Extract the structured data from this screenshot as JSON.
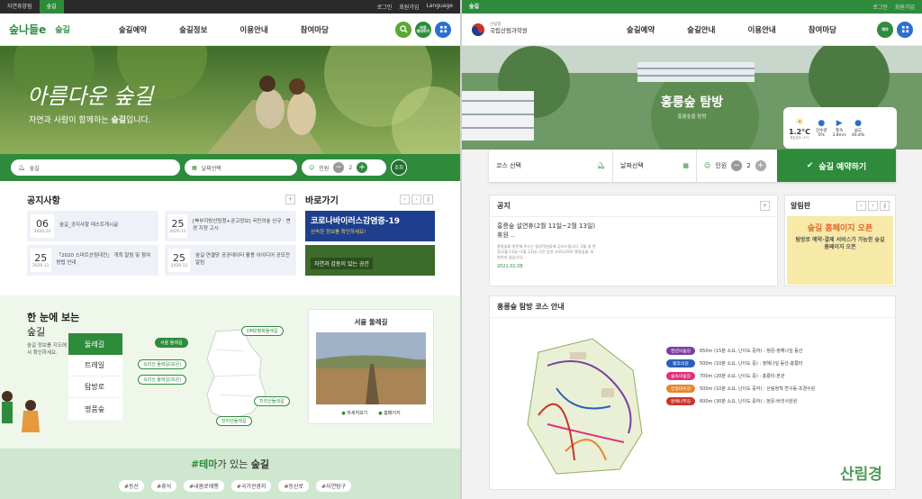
{
  "left": {
    "topbar": {
      "tabs": [
        "자연휴양림",
        "숲길"
      ],
      "util": [
        "로그인",
        "회원가입",
        "Language"
      ]
    },
    "logo": {
      "brand": "숲나들e",
      "section": "숲길"
    },
    "menu": [
      "숲길예약",
      "숲길정보",
      "이용안내",
      "참여마당"
    ],
    "nav_icons": {
      "search": "search-icon",
      "quick": "바로\n예약하기",
      "grid": "grid-icon"
    },
    "hero": {
      "title": "아름다운 숲길",
      "subtitle_pre": "자연과 사람이 함께하는 ",
      "subtitle_bold": "숲길",
      "subtitle_post": "입니다."
    },
    "search": {
      "forest": "숲길",
      "date": "날짜선택",
      "people_label": "인원",
      "people_count": "2",
      "submit": "조회"
    },
    "notice": {
      "title": "공지사항",
      "items": [
        {
          "day": "06",
          "date": "2020.12",
          "text": "숲길_공지사항 테스트게시글"
        },
        {
          "day": "25",
          "date": "2020.11",
          "text": "[북부지방산림청+공고정보] 국민의숲 신규 · 변경 지정 고시"
        },
        {
          "day": "25",
          "date": "2020.11",
          "text": "「2020 스마트산림대전」 개최 알림 및 참여방법 안내"
        },
        {
          "day": "25",
          "date": "2020.11",
          "text": "숲길 연결망 공공데이터 활용 아이디어 공모전 알림"
        }
      ]
    },
    "shortcut": {
      "title": "바로가기",
      "banner1": "코로나바이러스감염증-19",
      "banner1_sub": "신속한 정보를 확인하세요!",
      "banner2": "자연과 감동이 있는 공간"
    },
    "map_section": {
      "title_1": "한 눈에 보는",
      "title_2": "숲길",
      "desc": "숲길 정보를 지도에서 확인하세요.",
      "categories": [
        "둘레길",
        "트레일",
        "탐방로",
        "명품숲"
      ],
      "labels": [
        "서울 둘레길",
        "DMZ평화둘레길",
        "속리산 둘레길(보은)",
        "속리산 둘레길(보은)",
        "지리산둘레길",
        "한라산둘레길"
      ],
      "card_title": "서울 둘레길",
      "card_btn1": "자세히보기",
      "card_btn2": "홈페이지"
    },
    "theme": {
      "title_hash": "#테마",
      "title_mid": "가 있는 ",
      "title_end": "숲길",
      "tags": [
        "#등산",
        "#휴식",
        "#내몸로애행",
        "#국가관광지",
        "#등산로",
        "#자연탐구"
      ]
    }
  },
  "right": {
    "topbar": {
      "section": "숲길",
      "util": [
        "로그인",
        "회원가입"
      ]
    },
    "logo": {
      "org_small": "산림청",
      "org": "국립산림과학원"
    },
    "menu": [
      "숲길예약",
      "숲길안내",
      "이용안내",
      "참여마당"
    ],
    "hero": {
      "title": "홍릉숲 탐방",
      "subtitle": "홍릉숲을 탐방"
    },
    "weather": {
      "temp": "1.2°C",
      "temp_sub": "체감온도 -4°C",
      "items": [
        {
          "label": "강수량",
          "value": "0%"
        },
        {
          "label": "풍속",
          "value": "3.8m/s"
        },
        {
          "label": "습도",
          "value": "46.8%"
        }
      ]
    },
    "search": {
      "course": "코스 선택",
      "date": "날짜선택",
      "people_label": "인원",
      "people_count": "2",
      "submit": "숲길 예약하기"
    },
    "notice": {
      "title": "공지",
      "headline": "홍릉숲 설연휴(2월 11일~2월 13일) 휴원 ..",
      "body": "홍릉숲을 방문해 주시는 탐방객분들께 감사드립니다. 2월 설 연휴(2월 11일~2월 13일) 기간 동안 코로나19로 홍릉숲을 개방하지 않습니다.",
      "date": "2021.02.08"
    },
    "board": {
      "title": "알림판",
      "banner_title": "숲길 홈페이지 오픈",
      "banner_text": "탐방로 예약·결제 서비스가 가능한 숲길 홈페이지 오픈"
    },
    "course": {
      "title": "홍릉숲 탐방 코스 안내",
      "routes": [
        {
          "name": "천년의숲길",
          "color": "#7b3fa0",
          "desc": "650m (15분 소요, 난이도 중하) : 정문-정해나잎 동산"
        },
        {
          "name": "활후의길",
          "color": "#2b5fb8",
          "desc": "500m (10분 소요, 난이도 중) : 정해나잎 동산-홍릉터"
        },
        {
          "name": "숲속의쉼길",
          "color": "#e0307a",
          "desc": "700m (20분 소요, 난이도 중) : 홍릉터-본관"
        },
        {
          "name": "전정대우길",
          "color": "#e8852a",
          "desc": "500m (10분 소요, 난이도 중하) : 산림정책 연구동-조경수원"
        },
        {
          "name": "문배나무길",
          "color": "#c8342e",
          "desc": "600m (30분 소요, 난이도 중하) : 정문-버섯사원원"
        }
      ]
    },
    "watermark": "산림경"
  },
  "colors": {
    "accent": "#2e8b3c",
    "dark_green": "#1f6e2d",
    "blue": "#2a6fd1"
  }
}
